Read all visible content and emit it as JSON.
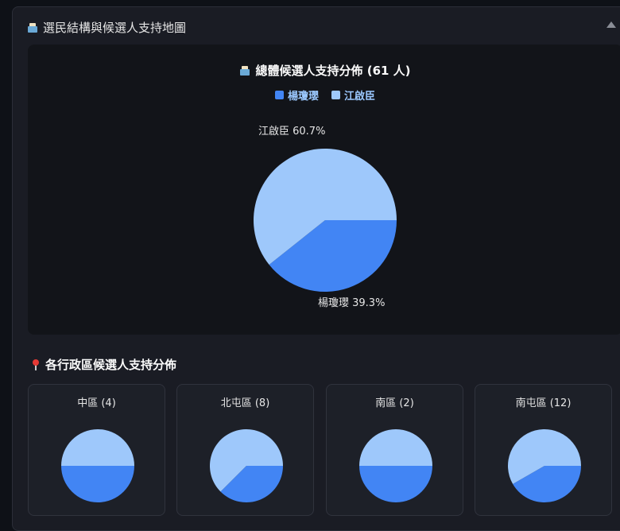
{
  "panel": {
    "title": "選民結構與候選人支持地圖"
  },
  "colors": {
    "yang": "#4285f4",
    "jiang": "#9ec8fb",
    "legend_text": "#9bc8ff"
  },
  "overall": {
    "title": "總體候選人支持分佈 (61 人)",
    "legend": [
      {
        "label": "楊瓊瓔",
        "color": "#4285f4"
      },
      {
        "label": "江啟臣",
        "color": "#9ec8fb"
      }
    ],
    "labels": {
      "jiang": "江啟臣 60.7%",
      "yang": "楊瓊瓔 39.3%"
    }
  },
  "districts_section": {
    "title": "各行政區候選人支持分佈"
  },
  "chart_data": [
    {
      "type": "pie",
      "title": "總體候選人支持分佈 (61 人)",
      "categories": [
        "楊瓊瓔",
        "江啟臣"
      ],
      "values": [
        39.3,
        60.7
      ],
      "legend": "top-center"
    },
    {
      "type": "pie",
      "title": "中區 (4)",
      "categories": [
        "楊瓊瓔",
        "江啟臣"
      ],
      "values": [
        50,
        50
      ]
    },
    {
      "type": "pie",
      "title": "北屯區 (8)",
      "categories": [
        "楊瓊瓔",
        "江啟臣"
      ],
      "values": [
        37.5,
        62.5
      ]
    },
    {
      "type": "pie",
      "title": "南區 (2)",
      "categories": [
        "楊瓊瓔",
        "江啟臣"
      ],
      "values": [
        50,
        50
      ]
    },
    {
      "type": "pie",
      "title": "南屯區 (12)",
      "categories": [
        "楊瓊瓔",
        "江啟臣"
      ],
      "values": [
        41.7,
        58.3
      ]
    }
  ]
}
